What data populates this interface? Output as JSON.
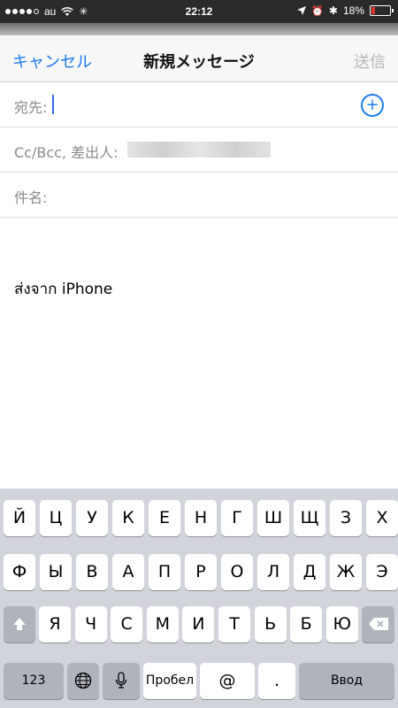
{
  "status_bar": {
    "carrier": "au",
    "time": "22:12",
    "battery_text": "18%",
    "battery_level": 0.18
  },
  "header": {
    "cancel_label": "キャンセル",
    "title": "新規メッセージ",
    "send_label": "送信"
  },
  "fields": {
    "to_label": "宛先:",
    "cc_label": "Cc/Bcc, 差出人:",
    "subject_label": "件名:"
  },
  "body": {
    "signature": "ส่งจาก iPhone"
  },
  "keyboard": {
    "row1": [
      "Й",
      "Ц",
      "У",
      "К",
      "Е",
      "Н",
      "Г",
      "Ш",
      "Щ",
      "З",
      "Х"
    ],
    "row2": [
      "Ф",
      "Ы",
      "В",
      "А",
      "П",
      "Р",
      "О",
      "Л",
      "Д",
      "Ж",
      "Э"
    ],
    "row3": [
      "Я",
      "Ч",
      "С",
      "М",
      "И",
      "Т",
      "Ь",
      "Б",
      "Ю"
    ],
    "numbers_label": "123",
    "space_label": "Пробел",
    "at_label": "@",
    "dot_label": ".",
    "return_label": "Ввод"
  }
}
